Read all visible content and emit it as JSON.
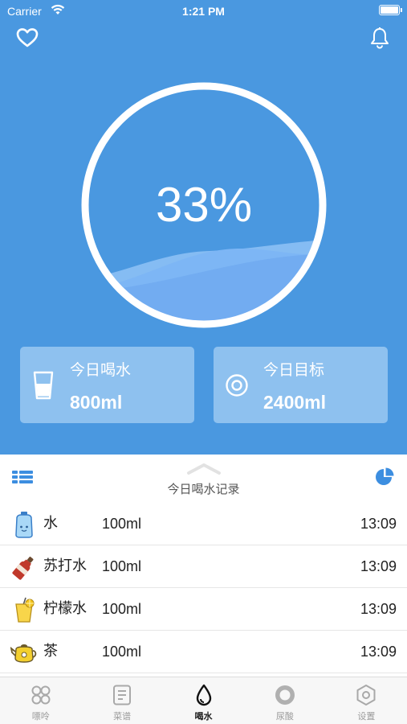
{
  "status_bar": {
    "carrier": "Carrier",
    "time": "1:21 PM"
  },
  "header": {
    "left_icon": "heart-outline-icon",
    "right_icon": "bell-icon"
  },
  "progress": {
    "percent_text": "33%",
    "fraction": 0.33
  },
  "cards": {
    "today_drink": {
      "label": "今日喝水",
      "value": "800ml",
      "icon": "glass-icon"
    },
    "today_goal": {
      "label": "今日目标",
      "value": "2400ml",
      "icon": "target-icon"
    }
  },
  "records": {
    "title": "今日喝水记录",
    "items": [
      {
        "name": "水",
        "amount": "100ml",
        "time": "13:09",
        "icon": "water-bottle-icon"
      },
      {
        "name": "苏打水",
        "amount": "100ml",
        "time": "13:09",
        "icon": "soda-bottle-icon"
      },
      {
        "name": "柠檬水",
        "amount": "100ml",
        "time": "13:09",
        "icon": "lemonade-icon"
      },
      {
        "name": "茶",
        "amount": "100ml",
        "time": "13:09",
        "icon": "teapot-icon"
      }
    ]
  },
  "tabs": [
    {
      "label": "嘌呤",
      "icon": "clover-icon",
      "active": false
    },
    {
      "label": "菜谱",
      "icon": "recipe-icon",
      "active": false
    },
    {
      "label": "喝水",
      "icon": "water-drop-icon",
      "active": true
    },
    {
      "label": "尿酸",
      "icon": "ring-icon",
      "active": false
    },
    {
      "label": "设置",
      "icon": "settings-hexagon-icon",
      "active": false
    }
  ],
  "colors": {
    "primary": "#4a98e0",
    "card": "#8ec1ef",
    "wave": "#7db6f5",
    "list_accent": "#3c8ee0"
  }
}
